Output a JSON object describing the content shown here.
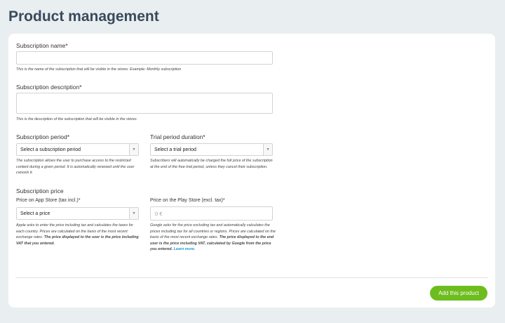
{
  "page": {
    "title": "Product management"
  },
  "form": {
    "name": {
      "label": "Subscription name*",
      "value": "",
      "help": "This is the name of the subscription that will be visible in the stores. Example: Monthly subscription"
    },
    "description": {
      "label": "Subscription description*",
      "value": "",
      "help": "This is the description of the subscription that will be visible in the stores"
    },
    "period": {
      "label": "Subscription period*",
      "selected": "Select a subscription period",
      "help": "The subscription allows the user to purchase access to the restricted content during a given period. It is automatically renewed until the user cancels it."
    },
    "trial": {
      "label": "Trial period duration*",
      "selected": "Select a trial period",
      "help": "Subscribers will automatically be charged the full price of the subscription at the end of the free trial period, unless they cancel their subscription."
    },
    "price_section_title": "Subscription price",
    "appstore": {
      "label": "Price on App Store (tax incl.)*",
      "selected": "Select a price",
      "help_text": "Apple asks to enter the price including tax and calculates the taxes for each country. Prices are calculated on the basis of the most recent exchange rates. ",
      "help_bold": "The price displayed to the user is the price including VAT that you entered."
    },
    "playstore": {
      "label": "Price on the Play Store (excl. tax)*",
      "placeholder": "0 €",
      "help_text": "Google asks for the price excluding tax and automatically calculates the prices including tax for all countries or regions. Prices are calculated on the basis of the most recent exchange rates. ",
      "help_bold": "The price displayed to the end user is the price including VAT, calculated by Google from the price you entered.",
      "learn_more": "Learn more."
    },
    "submit_label": "Add this product"
  },
  "colors": {
    "background": "#e9eef0",
    "card": "#ffffff",
    "title": "#3a4a5c",
    "accent_button": "#6cbd1d",
    "link": "#1a9ad6"
  },
  "icons": {
    "select_caret": "caret-down-icon"
  }
}
